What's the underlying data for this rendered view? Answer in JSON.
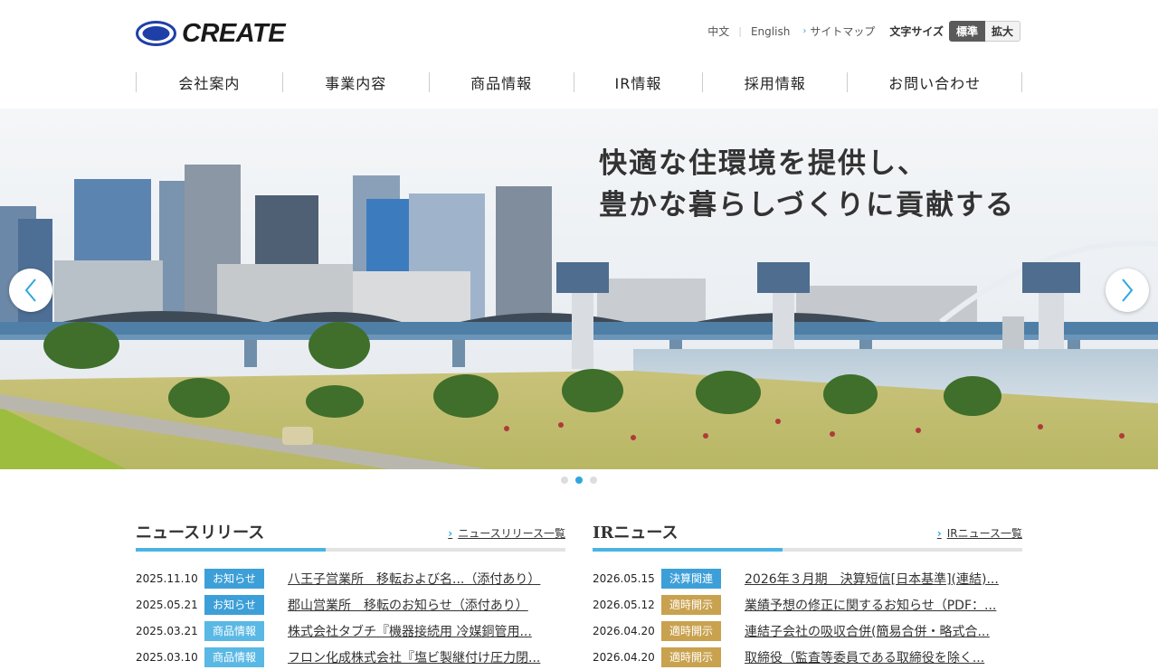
{
  "header": {
    "logo_text": "CREATE",
    "util": {
      "lang_cn": "中文",
      "lang_sep": "|",
      "lang_en": "English",
      "sitemap": "サイトマップ",
      "font_size_label": "文字サイズ",
      "font_standard": "標準",
      "font_large": "拡大"
    },
    "nav": [
      {
        "label": "会社案内"
      },
      {
        "label": "事業内容"
      },
      {
        "label": "商品情報"
      },
      {
        "label": "IR情報"
      },
      {
        "label": "採用情報"
      },
      {
        "label": "お問い合わせ"
      }
    ]
  },
  "hero": {
    "line1": "快適な住環境を提供し、",
    "line2": "豊かな暮らしづくりに貢献する",
    "slides": 3,
    "active_slide": 2
  },
  "news": {
    "title": "ニュースリリース",
    "more": "ニュースリリース一覧",
    "items": [
      {
        "date": "2025.11.10",
        "category": "お知らせ",
        "title": "八王子営業所　移転および名...（添付あり）"
      },
      {
        "date": "2025.05.21",
        "category": "お知らせ",
        "title": "郡山営業所　移転のお知らせ（添付あり）"
      },
      {
        "date": "2025.03.21",
        "category": "商品情報",
        "title": "株式会社タブチ『機器接続用 冷媒銅管用..."
      },
      {
        "date": "2025.03.10",
        "category": "商品情報",
        "title": "フロン化成株式会社『塩ビ製継付け圧力閉..."
      }
    ]
  },
  "ir": {
    "title": "IRニュース",
    "more": "IRニュース一覧",
    "items": [
      {
        "date": "2026.05.15",
        "category": "決算関連",
        "title": "2026年３月期　決算短信[日本基準](連結)..."
      },
      {
        "date": "2026.05.12",
        "category": "適時開示",
        "title": "業績予想の修正に関するお知らせ（PDF：..."
      },
      {
        "date": "2026.04.20",
        "category": "適時開示",
        "title": "連結子会社の吸収合併(簡易合併・略式合..."
      },
      {
        "date": "2026.04.20",
        "category": "適時開示",
        "title": "取締役（監査等委員である取締役を除く..."
      }
    ]
  },
  "colors": {
    "accent": "#2ea7e0",
    "cat_oshirase": "#3d9fd8",
    "cat_shohin": "#5ab8e4",
    "cat_kessan": "#3d9fd8",
    "cat_tekiji": "#c9a24f"
  }
}
